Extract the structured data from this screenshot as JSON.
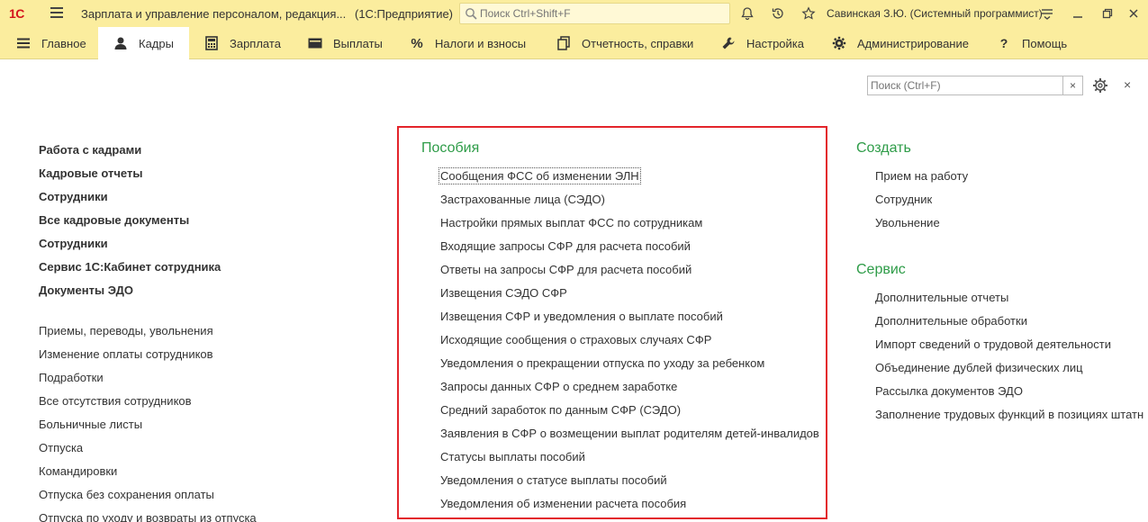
{
  "app": {
    "logo": "1С",
    "title": "Зарплата и управление персоналом, редакция...",
    "mode": "(1С:Предприятие)",
    "search_placeholder": "Поиск Ctrl+Shift+F",
    "user": "Савинская З.Ю. (Системный программист)"
  },
  "sections": [
    {
      "label": "Главное",
      "icon": "hamburger-icon"
    },
    {
      "label": "Кадры",
      "icon": "person-icon"
    },
    {
      "label": "Зарплата",
      "icon": "calculator-icon"
    },
    {
      "label": "Выплаты",
      "icon": "wallet-icon"
    },
    {
      "label": "Налоги и взносы",
      "icon": "percent-icon"
    },
    {
      "label": "Отчетность, справки",
      "icon": "documents-icon"
    },
    {
      "label": "Настройка",
      "icon": "wrench-icon"
    },
    {
      "label": "Администрирование",
      "icon": "gear-icon"
    },
    {
      "label": "Помощь",
      "icon": "question-icon"
    }
  ],
  "active_section": "Кадры",
  "panel": {
    "search_placeholder": "Поиск (Ctrl+F)",
    "clear": "×",
    "close": "×"
  },
  "left": {
    "bold": [
      "Работа с кадрами",
      "Кадровые отчеты",
      "Сотрудники",
      "Все кадровые документы",
      "Сотрудники",
      "Сервис 1С:Кабинет сотрудника",
      "Документы ЭДО"
    ],
    "plain": [
      "Приемы, переводы, увольнения",
      "Изменение оплаты сотрудников",
      "Подработки",
      "Все отсутствия сотрудников",
      "Больничные листы",
      "Отпуска",
      "Командировки",
      "Отпуска без сохранения оплаты",
      "Отпуска по уходу и возвраты из отпуска"
    ]
  },
  "benefits": {
    "title": "Пособия",
    "items": [
      "Сообщения ФСС об изменении ЭЛН",
      "Застрахованные лица (СЭДО)",
      "Настройки прямых выплат ФСС по сотрудникам",
      "Входящие запросы СФР для расчета пособий",
      "Ответы на запросы СФР для расчета пособий",
      "Извещения СЭДО СФР",
      "Извещения СФР и уведомления о выплате пособий",
      "Исходящие сообщения о страховых случаях СФР",
      "Уведомления о прекращении отпуска по уходу за ребенком",
      "Запросы данных СФР о среднем заработке",
      "Средний заработок по данным СФР (СЭДО)",
      "Заявления в СФР о возмещении выплат родителям детей-инвалидов",
      "Статусы выплаты пособий",
      "Уведомления о статусе выплаты пособий",
      "Уведомления об изменении расчета пособия"
    ]
  },
  "create": {
    "title": "Создать",
    "items": [
      "Прием на работу",
      "Сотрудник",
      "Увольнение"
    ]
  },
  "service": {
    "title": "Сервис",
    "items": [
      "Дополнительные отчеты",
      "Дополнительные обработки",
      "Импорт сведений о трудовой деятельности",
      "Объединение дублей физических лиц",
      "Рассылка документов ЭДО",
      "Заполнение трудовых функций в позициях штатн"
    ]
  },
  "colors": {
    "bar_bg": "#fbed9e",
    "group_title": "#2e9c48",
    "highlight": "#e3242b",
    "logo": "#d4141c"
  }
}
